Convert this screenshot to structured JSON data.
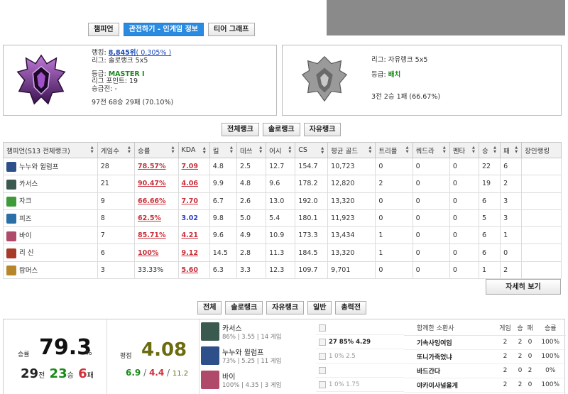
{
  "top_tabs": [
    "챔피언",
    "관전하기 - 인게임 정보",
    "티어 그래프"
  ],
  "solo": {
    "rank_label": "랭킹:",
    "rank_value": "8,845위",
    "rank_pct": "( 0.305% )",
    "league": "리그: 솔로랭크 5x5",
    "tier_label": "등급:",
    "tier_value": "MASTER I",
    "lp": "리그 포인트: 19",
    "promo": "승급전: -",
    "record": "97전 68승 29패 (70.10%)"
  },
  "flex": {
    "league": "리그: 자유랭크 5x5",
    "tier_label": "등급:",
    "tier_value": "배치",
    "record": "3전 2승 1패 (66.67%)"
  },
  "mode_tabs": [
    "전체랭크",
    "솔로랭크",
    "자유랭크"
  ],
  "table": {
    "headers": [
      "챔피언(S13 전체랭크)",
      "게임수",
      "승률",
      "KDA",
      "킬",
      "데쓰",
      "어시",
      "CS",
      "평균 골드",
      "트리플",
      "쿼드라",
      "펜타",
      "승",
      "패",
      "장인랭킹"
    ],
    "rows": [
      {
        "name": "누누와 윌럼프",
        "color": "#2d4f8a",
        "games": "28",
        "wr": "78.57%",
        "kda": "7.09",
        "k": "4.8",
        "d": "2.5",
        "a": "12.7",
        "cs": "154.7",
        "gold": "10,723",
        "triple": "0",
        "quadra": "0",
        "penta": "0",
        "w": "22",
        "l": "6"
      },
      {
        "name": "카서스",
        "color": "#3a5a50",
        "games": "21",
        "wr": "90.47%",
        "kda": "4.06",
        "k": "9.9",
        "d": "4.8",
        "a": "9.6",
        "cs": "178.2",
        "gold": "12,820",
        "triple": "2",
        "quadra": "0",
        "penta": "0",
        "w": "19",
        "l": "2"
      },
      {
        "name": "자크",
        "color": "#3f9a3a",
        "games": "9",
        "wr": "66.66%",
        "kda": "7.70",
        "k": "6.7",
        "d": "2.6",
        "a": "13.0",
        "cs": "192.0",
        "gold": "13,320",
        "triple": "0",
        "quadra": "0",
        "penta": "0",
        "w": "6",
        "l": "3"
      },
      {
        "name": "피즈",
        "color": "#2a6fa8",
        "games": "8",
        "wr": "62.5%",
        "kda": "3.02",
        "k": "9.8",
        "d": "5.0",
        "a": "5.4",
        "cs": "180.1",
        "gold": "11,923",
        "triple": "0",
        "quadra": "0",
        "penta": "0",
        "w": "5",
        "l": "3"
      },
      {
        "name": "바이",
        "color": "#b04a6a",
        "games": "7",
        "wr": "85.71%",
        "kda": "4.21",
        "k": "9.6",
        "d": "4.9",
        "a": "10.9",
        "cs": "173.3",
        "gold": "13,434",
        "triple": "1",
        "quadra": "0",
        "penta": "0",
        "w": "6",
        "l": "1"
      },
      {
        "name": "리 신",
        "color": "#a83a2a",
        "games": "6",
        "wr": "100%",
        "kda": "9.12",
        "k": "14.5",
        "d": "2.8",
        "a": "11.3",
        "cs": "184.5",
        "gold": "13,320",
        "triple": "1",
        "quadra": "0",
        "penta": "0",
        "w": "6",
        "l": "0"
      },
      {
        "name": "람머스",
        "color": "#b8862a",
        "games": "3",
        "wr": "33.33%",
        "kda": "5.60",
        "k": "6.3",
        "d": "3.3",
        "a": "12.3",
        "cs": "109.7",
        "gold": "9,701",
        "triple": "0",
        "quadra": "0",
        "penta": "0",
        "w": "1",
        "l": "2"
      }
    ]
  },
  "detail_button": "자세히 보기",
  "filter_tabs": [
    "전체",
    "솔로랭크",
    "자유랭크",
    "일반",
    "총력전"
  ],
  "summary": {
    "wr_label": "승률",
    "wr_value": "79.3",
    "wr_pct": "%",
    "games": "29",
    "games_unit": "전",
    "wins": "23",
    "wins_unit": "승",
    "losses": "6",
    "losses_unit": "패",
    "kda_label": "평점",
    "kda_value": "4.08",
    "k": "6.9",
    "d": "4.4",
    "a": "11.2"
  },
  "recent_champs": [
    {
      "name": "카서스",
      "stats": "86% | 3.55 | 14 게임",
      "color": "#3a5a50"
    },
    {
      "name": "누누와 윌럼프",
      "stats": "73% | 5.25 | 11 게임",
      "color": "#2d4f8a"
    },
    {
      "name": "바이",
      "stats": "100% | 4.35 | 3 게임",
      "color": "#b04a6a"
    }
  ],
  "spells": [
    {
      "text": "",
      "strong": false
    },
    {
      "text": "27  85%  4.29",
      "strong": true
    },
    {
      "text": "1  0%  2.5",
      "strong": false
    },
    {
      "text": "",
      "strong": false
    },
    {
      "text": "1  0%  1.75",
      "strong": false
    }
  ],
  "duo": {
    "headers": [
      "함께한 소환사",
      "게임",
      "승",
      "패",
      "승률"
    ],
    "rows": [
      [
        "기속사잉여임",
        "2",
        "2",
        "0",
        "100%"
      ],
      [
        "또니가죽었냐",
        "2",
        "2",
        "0",
        "100%"
      ],
      [
        "바드간다",
        "2",
        "0",
        "2",
        "0%"
      ],
      [
        "야카이사널을게",
        "2",
        "2",
        "0",
        "100%"
      ]
    ]
  }
}
